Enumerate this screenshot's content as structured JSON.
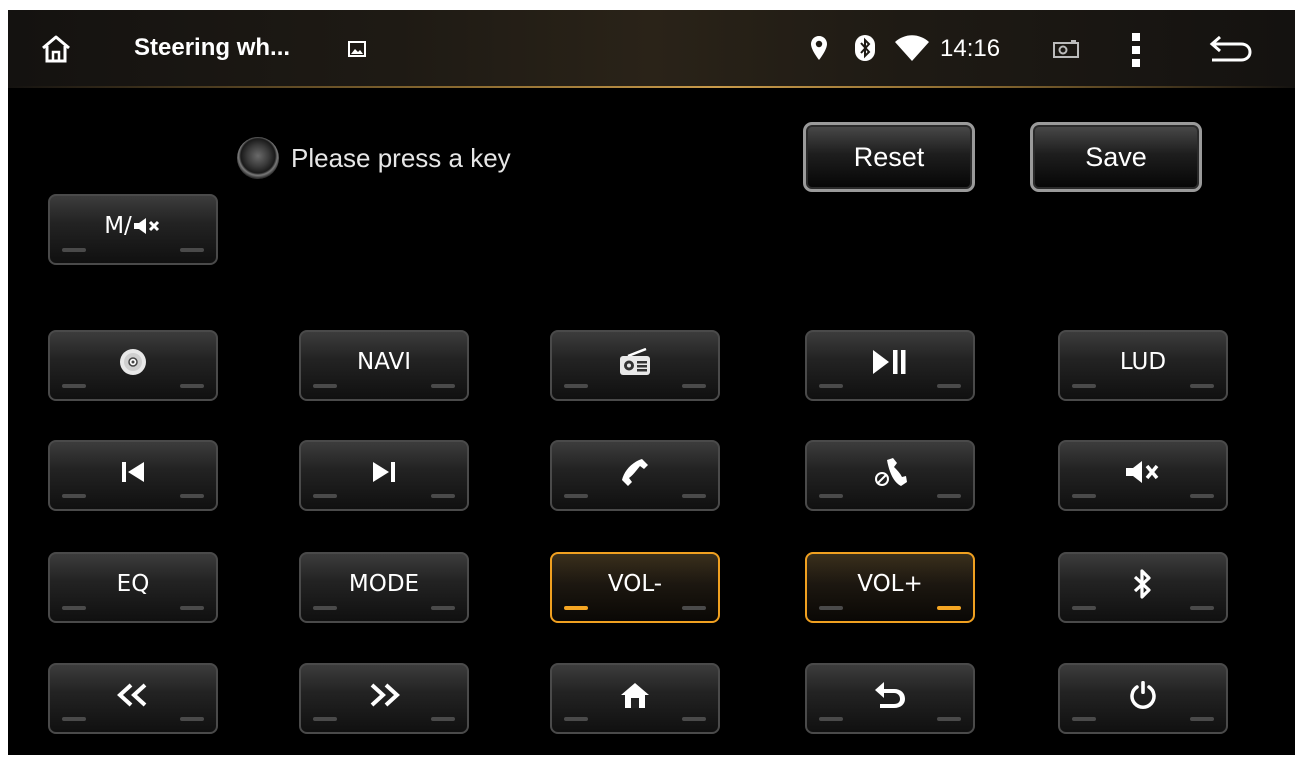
{
  "status_bar": {
    "title": "Steering wh...",
    "time": "14:16",
    "icons": [
      "home-icon",
      "image-icon",
      "location-icon",
      "bluetooth-icon",
      "wifi-icon",
      "screenshot-icon",
      "more-vert-icon",
      "back-icon"
    ]
  },
  "prompt": {
    "text": "Please press a key"
  },
  "actions": {
    "reset": "Reset",
    "save": "Save"
  },
  "mute_mode_key": {
    "label": "M/",
    "icon": "mute-icon"
  },
  "keys": [
    {
      "label": "",
      "icon": "disc-icon",
      "active": false
    },
    {
      "label": "NAVI",
      "icon": "",
      "active": false
    },
    {
      "label": "",
      "icon": "radio-icon",
      "active": false
    },
    {
      "label": "",
      "icon": "play-pause-icon",
      "active": false
    },
    {
      "label": "LUD",
      "icon": "",
      "active": false
    },
    {
      "label": "",
      "icon": "previous-icon",
      "active": false
    },
    {
      "label": "",
      "icon": "next-icon",
      "active": false
    },
    {
      "label": "",
      "icon": "phone-answer-icon",
      "active": false
    },
    {
      "label": "",
      "icon": "phone-hangup-icon",
      "active": false
    },
    {
      "label": "",
      "icon": "mute-icon",
      "active": false
    },
    {
      "label": "EQ",
      "icon": "",
      "active": false
    },
    {
      "label": "MODE",
      "icon": "",
      "active": false
    },
    {
      "label": "VOL-",
      "icon": "",
      "active": true
    },
    {
      "label": "VOL+",
      "icon": "",
      "active": true
    },
    {
      "label": "",
      "icon": "bluetooth-icon",
      "active": false
    },
    {
      "label": "",
      "icon": "rewind-icon",
      "active": false
    },
    {
      "label": "",
      "icon": "fast-forward-icon",
      "active": false
    },
    {
      "label": "",
      "icon": "home-icon",
      "active": false
    },
    {
      "label": "",
      "icon": "back-icon",
      "active": false
    },
    {
      "label": "",
      "icon": "power-icon",
      "active": false
    }
  ],
  "colors": {
    "accent": "#f5a623",
    "background": "#000000",
    "key_border": "#4a4a4a"
  }
}
